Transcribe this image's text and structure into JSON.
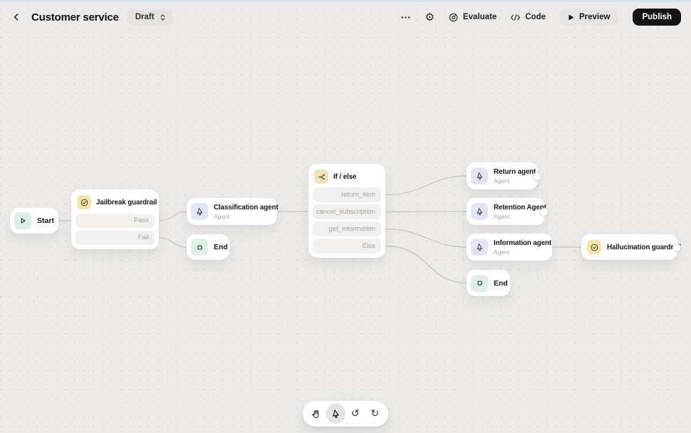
{
  "header": {
    "title": "Customer service",
    "status": "Draft",
    "evaluate_label": "Evaluate",
    "code_label": "Code",
    "preview_label": "Preview",
    "publish_label": "Publish"
  },
  "icons": {
    "gear": "⚙",
    "undo": "↺",
    "redo": "↻"
  },
  "nodes": {
    "start": {
      "label": "Start"
    },
    "jailbreak": {
      "title": "Jailbreak guardrail",
      "outputs": [
        "Pass",
        "Fail"
      ]
    },
    "classification": {
      "title": "Classification agent",
      "subtitle": "Agent"
    },
    "end_top": {
      "label": "End"
    },
    "ifelse": {
      "title": "If / else",
      "branches": [
        "return_item",
        "cancel_subscription",
        "get_information",
        "Else"
      ]
    },
    "return_agent": {
      "title": "Return agent",
      "subtitle": "Agent"
    },
    "retention_agent": {
      "title": "Retention Agent",
      "subtitle": "Agent"
    },
    "information_agent": {
      "title": "Information agent",
      "subtitle": "Agent"
    },
    "end_bottom": {
      "label": "End"
    },
    "hallucination": {
      "title": "Hallucination guardrail"
    }
  },
  "colors": {
    "publish_bg": "#141414",
    "agent_icon_bg": "#e2e4f7",
    "guardrail_icon_bg": "#f5e7a8",
    "branch_icon_bg": "#efe2ba",
    "terminal_icon_bg": "#dfeee6",
    "edge": "#c9c8c5",
    "canvas_bg": "#ecebe9"
  }
}
